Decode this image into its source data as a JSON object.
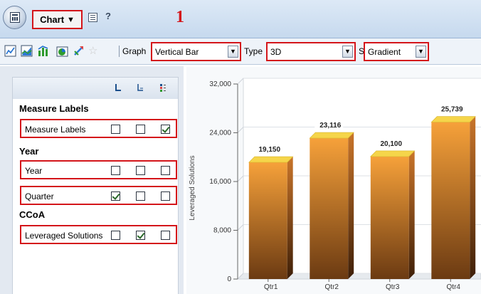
{
  "header": {
    "menu_label": "Chart",
    "step_number": "1"
  },
  "toolbar": {
    "icons": [
      "line-chart-icon",
      "area-chart-icon",
      "combo-chart-icon",
      "pie-chart-icon",
      "drill-icon",
      "favorite-star-icon"
    ],
    "graph_label": "Graph",
    "graph_value": "Vertical Bar",
    "type_label": "Type",
    "type_value": "3D",
    "style_label": "Style",
    "style_value": "Gradient"
  },
  "panel": {
    "sections": [
      {
        "title": "Measure Labels",
        "rows": [
          {
            "label": "Measure Labels",
            "checks": [
              false,
              false,
              true
            ]
          }
        ]
      },
      {
        "title": "Year",
        "rows": [
          {
            "label": "Year",
            "checks": [
              false,
              false,
              false
            ]
          },
          {
            "label": "Quarter",
            "checks": [
              true,
              false,
              false
            ]
          }
        ]
      },
      {
        "title": "CCoA",
        "rows": [
          {
            "label": "Leveraged Solutions",
            "checks": [
              false,
              true,
              false
            ]
          }
        ]
      }
    ]
  },
  "chart_data": {
    "type": "bar",
    "categories": [
      "Qtr1",
      "Qtr2",
      "Qtr3",
      "Qtr4"
    ],
    "values": [
      19150,
      23116,
      20100,
      25739
    ],
    "value_labels": [
      "19,150",
      "23,116",
      "20,100",
      "25,739"
    ],
    "ylabel": "Leveraged Solutions",
    "ylim": [
      0,
      32000
    ],
    "yticks": [
      0,
      8000,
      16000,
      24000,
      32000
    ],
    "ytick_labels": [
      "0",
      "8,000",
      "16,000",
      "24,000",
      "32,000"
    ],
    "grid": true,
    "colors": {
      "bar_top": "#f6a13a",
      "bar_bottom": "#6b3a12",
      "cap": "#f5d54a"
    }
  }
}
